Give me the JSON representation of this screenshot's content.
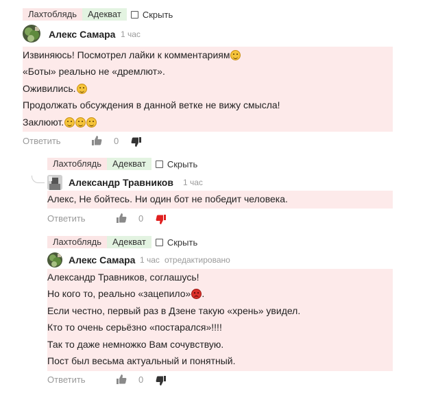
{
  "comments": [
    {
      "tags": {
        "bad": "Лахтоблядь",
        "good": "Адекват",
        "hide": "Скрыть"
      },
      "author": "Алекс Самара",
      "time": "1 час",
      "edited": "",
      "lines": [
        {
          "text": "Извиняюсь! Посмотрел лайки к комментариям",
          "emoji": [
            "laughing-face-icon"
          ]
        },
        {
          "text": "«Боты» реально не «дремлют».",
          "emoji": []
        },
        {
          "text": "Оживились.",
          "emoji": [
            "tears-of-joy-icon"
          ]
        },
        {
          "text": "Продолжать обсуждения в данной ветке не вижу смысла!",
          "emoji": []
        },
        {
          "text": "Заклюют.",
          "emoji": [
            "laughing-face-icon",
            "grinning-sweat-icon",
            "sad-face-icon"
          ]
        }
      ],
      "reply_label": "Ответить",
      "likes": "0",
      "dislike_active": false
    },
    {
      "tags": {
        "bad": "Лахтоблядь",
        "good": "Адекват",
        "hide": "Скрыть"
      },
      "author": "Александр Травников",
      "time": "1 час",
      "edited": "",
      "lines": [
        {
          "text": "Алекс, Не бойтесь. Ни один бот не победит человека.",
          "emoji": []
        }
      ],
      "reply_label": "Ответить",
      "likes": "0",
      "dislike_active": true
    },
    {
      "tags": {
        "bad": "Лахтоблядь",
        "good": "Адекват",
        "hide": "Скрыть"
      },
      "author": "Алекс Самара",
      "time": "1 час",
      "edited": "отредактировано",
      "lines": [
        {
          "text": "Александр Травников, соглашусь!",
          "emoji": []
        },
        {
          "text": "Но кого то, реально «зацепило»",
          "emoji": [
            "angry-face-icon"
          ],
          "suffix": "."
        },
        {
          "text": "Если честно, первый раз в Дзене такую «хрень» увидел.",
          "emoji": []
        },
        {
          "text": "Кто то очень серьёзно «постарался»!!!!",
          "emoji": []
        },
        {
          "text": "Так то даже немножко Вам сочувствую.",
          "emoji": []
        },
        {
          "text": "Пост был весьма актуальный и понятный.",
          "emoji": []
        }
      ],
      "reply_label": "Ответить",
      "likes": "0",
      "dislike_active": false
    }
  ],
  "colors": {
    "tag_bad_bg": "#fbe6e6",
    "tag_good_bg": "#e3f3e1",
    "comment_bg": "#fdeaea",
    "muted": "#999999",
    "dislike_active": "#e02020"
  },
  "icons": {
    "like": "thumbs-up-icon",
    "dislike": "thumbs-down-icon",
    "avatar_1": "avatar-plant",
    "avatar_2": "avatar-gray",
    "connector": "reply-thread-line"
  }
}
